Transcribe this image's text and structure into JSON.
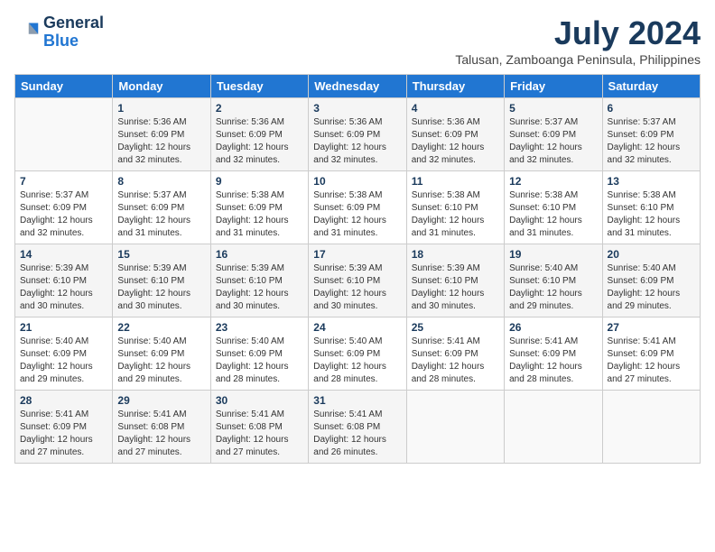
{
  "header": {
    "logo_line1": "General",
    "logo_line2": "Blue",
    "month": "July 2024",
    "location": "Talusan, Zamboanga Peninsula, Philippines"
  },
  "weekdays": [
    "Sunday",
    "Monday",
    "Tuesday",
    "Wednesday",
    "Thursday",
    "Friday",
    "Saturday"
  ],
  "weeks": [
    [
      {
        "day": "",
        "info": ""
      },
      {
        "day": "1",
        "info": "Sunrise: 5:36 AM\nSunset: 6:09 PM\nDaylight: 12 hours\nand 32 minutes."
      },
      {
        "day": "2",
        "info": "Sunrise: 5:36 AM\nSunset: 6:09 PM\nDaylight: 12 hours\nand 32 minutes."
      },
      {
        "day": "3",
        "info": "Sunrise: 5:36 AM\nSunset: 6:09 PM\nDaylight: 12 hours\nand 32 minutes."
      },
      {
        "day": "4",
        "info": "Sunrise: 5:36 AM\nSunset: 6:09 PM\nDaylight: 12 hours\nand 32 minutes."
      },
      {
        "day": "5",
        "info": "Sunrise: 5:37 AM\nSunset: 6:09 PM\nDaylight: 12 hours\nand 32 minutes."
      },
      {
        "day": "6",
        "info": "Sunrise: 5:37 AM\nSunset: 6:09 PM\nDaylight: 12 hours\nand 32 minutes."
      }
    ],
    [
      {
        "day": "7",
        "info": "Sunrise: 5:37 AM\nSunset: 6:09 PM\nDaylight: 12 hours\nand 32 minutes."
      },
      {
        "day": "8",
        "info": "Sunrise: 5:37 AM\nSunset: 6:09 PM\nDaylight: 12 hours\nand 31 minutes."
      },
      {
        "day": "9",
        "info": "Sunrise: 5:38 AM\nSunset: 6:09 PM\nDaylight: 12 hours\nand 31 minutes."
      },
      {
        "day": "10",
        "info": "Sunrise: 5:38 AM\nSunset: 6:09 PM\nDaylight: 12 hours\nand 31 minutes."
      },
      {
        "day": "11",
        "info": "Sunrise: 5:38 AM\nSunset: 6:10 PM\nDaylight: 12 hours\nand 31 minutes."
      },
      {
        "day": "12",
        "info": "Sunrise: 5:38 AM\nSunset: 6:10 PM\nDaylight: 12 hours\nand 31 minutes."
      },
      {
        "day": "13",
        "info": "Sunrise: 5:38 AM\nSunset: 6:10 PM\nDaylight: 12 hours\nand 31 minutes."
      }
    ],
    [
      {
        "day": "14",
        "info": "Sunrise: 5:39 AM\nSunset: 6:10 PM\nDaylight: 12 hours\nand 30 minutes."
      },
      {
        "day": "15",
        "info": "Sunrise: 5:39 AM\nSunset: 6:10 PM\nDaylight: 12 hours\nand 30 minutes."
      },
      {
        "day": "16",
        "info": "Sunrise: 5:39 AM\nSunset: 6:10 PM\nDaylight: 12 hours\nand 30 minutes."
      },
      {
        "day": "17",
        "info": "Sunrise: 5:39 AM\nSunset: 6:10 PM\nDaylight: 12 hours\nand 30 minutes."
      },
      {
        "day": "18",
        "info": "Sunrise: 5:39 AM\nSunset: 6:10 PM\nDaylight: 12 hours\nand 30 minutes."
      },
      {
        "day": "19",
        "info": "Sunrise: 5:40 AM\nSunset: 6:10 PM\nDaylight: 12 hours\nand 29 minutes."
      },
      {
        "day": "20",
        "info": "Sunrise: 5:40 AM\nSunset: 6:09 PM\nDaylight: 12 hours\nand 29 minutes."
      }
    ],
    [
      {
        "day": "21",
        "info": "Sunrise: 5:40 AM\nSunset: 6:09 PM\nDaylight: 12 hours\nand 29 minutes."
      },
      {
        "day": "22",
        "info": "Sunrise: 5:40 AM\nSunset: 6:09 PM\nDaylight: 12 hours\nand 29 minutes."
      },
      {
        "day": "23",
        "info": "Sunrise: 5:40 AM\nSunset: 6:09 PM\nDaylight: 12 hours\nand 28 minutes."
      },
      {
        "day": "24",
        "info": "Sunrise: 5:40 AM\nSunset: 6:09 PM\nDaylight: 12 hours\nand 28 minutes."
      },
      {
        "day": "25",
        "info": "Sunrise: 5:41 AM\nSunset: 6:09 PM\nDaylight: 12 hours\nand 28 minutes."
      },
      {
        "day": "26",
        "info": "Sunrise: 5:41 AM\nSunset: 6:09 PM\nDaylight: 12 hours\nand 28 minutes."
      },
      {
        "day": "27",
        "info": "Sunrise: 5:41 AM\nSunset: 6:09 PM\nDaylight: 12 hours\nand 27 minutes."
      }
    ],
    [
      {
        "day": "28",
        "info": "Sunrise: 5:41 AM\nSunset: 6:09 PM\nDaylight: 12 hours\nand 27 minutes."
      },
      {
        "day": "29",
        "info": "Sunrise: 5:41 AM\nSunset: 6:08 PM\nDaylight: 12 hours\nand 27 minutes."
      },
      {
        "day": "30",
        "info": "Sunrise: 5:41 AM\nSunset: 6:08 PM\nDaylight: 12 hours\nand 27 minutes."
      },
      {
        "day": "31",
        "info": "Sunrise: 5:41 AM\nSunset: 6:08 PM\nDaylight: 12 hours\nand 26 minutes."
      },
      {
        "day": "",
        "info": ""
      },
      {
        "day": "",
        "info": ""
      },
      {
        "day": "",
        "info": ""
      }
    ]
  ]
}
